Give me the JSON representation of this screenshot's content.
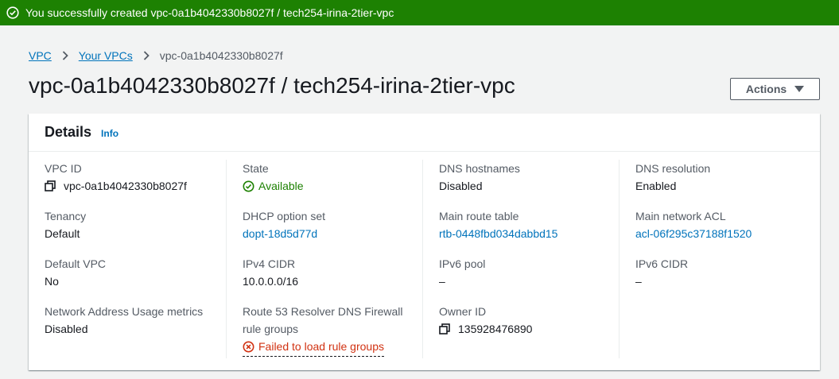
{
  "flash": {
    "message": "You successfully created vpc-0a1b4042330b8027f / tech254-irina-2tier-vpc",
    "icon": "check-circle-icon",
    "color": "#1d8102"
  },
  "breadcrumb": {
    "items": [
      "VPC",
      "Your VPCs"
    ],
    "current": "vpc-0a1b4042330b8027f"
  },
  "page": {
    "title": "vpc-0a1b4042330b8027f / tech254-irina-2tier-vpc",
    "actions_label": "Actions"
  },
  "details": {
    "title": "Details",
    "info": "Info",
    "columns": [
      [
        {
          "label": "VPC ID",
          "value": "vpc-0a1b4042330b8027f"
        },
        {
          "label": "Tenancy",
          "value": "Default"
        },
        {
          "label": "Default VPC",
          "value": "No"
        },
        {
          "label": "Network Address Usage metrics",
          "value": "Disabled"
        }
      ],
      [
        {
          "label": "State",
          "value": "Available"
        },
        {
          "label": "DHCP option set",
          "value": "dopt-18d5d77d"
        },
        {
          "label": "IPv4 CIDR",
          "value": "10.0.0.0/16"
        },
        {
          "label_line1": "Route 53 Resolver DNS Firewall",
          "label_line2": "rule groups",
          "value": "Failed to load rule groups"
        }
      ],
      [
        {
          "label": "DNS hostnames",
          "value": "Disabled"
        },
        {
          "label": "Main route table",
          "value": "rtb-0448fbd034dabbd15"
        },
        {
          "label": "IPv6 pool",
          "value": "–"
        },
        {
          "label": "Owner ID",
          "value": "135928476890"
        }
      ],
      [
        {
          "label": "DNS resolution",
          "value": "Enabled"
        },
        {
          "label": "Main network ACL",
          "value": "acl-06f295c37188f1520"
        },
        {
          "label": "IPv6 CIDR",
          "value": "–"
        }
      ]
    ]
  },
  "colors": {
    "link": "#0073bb",
    "success": "#1d8102",
    "error": "#d13212",
    "text": "#16191f",
    "label": "#545b64"
  }
}
